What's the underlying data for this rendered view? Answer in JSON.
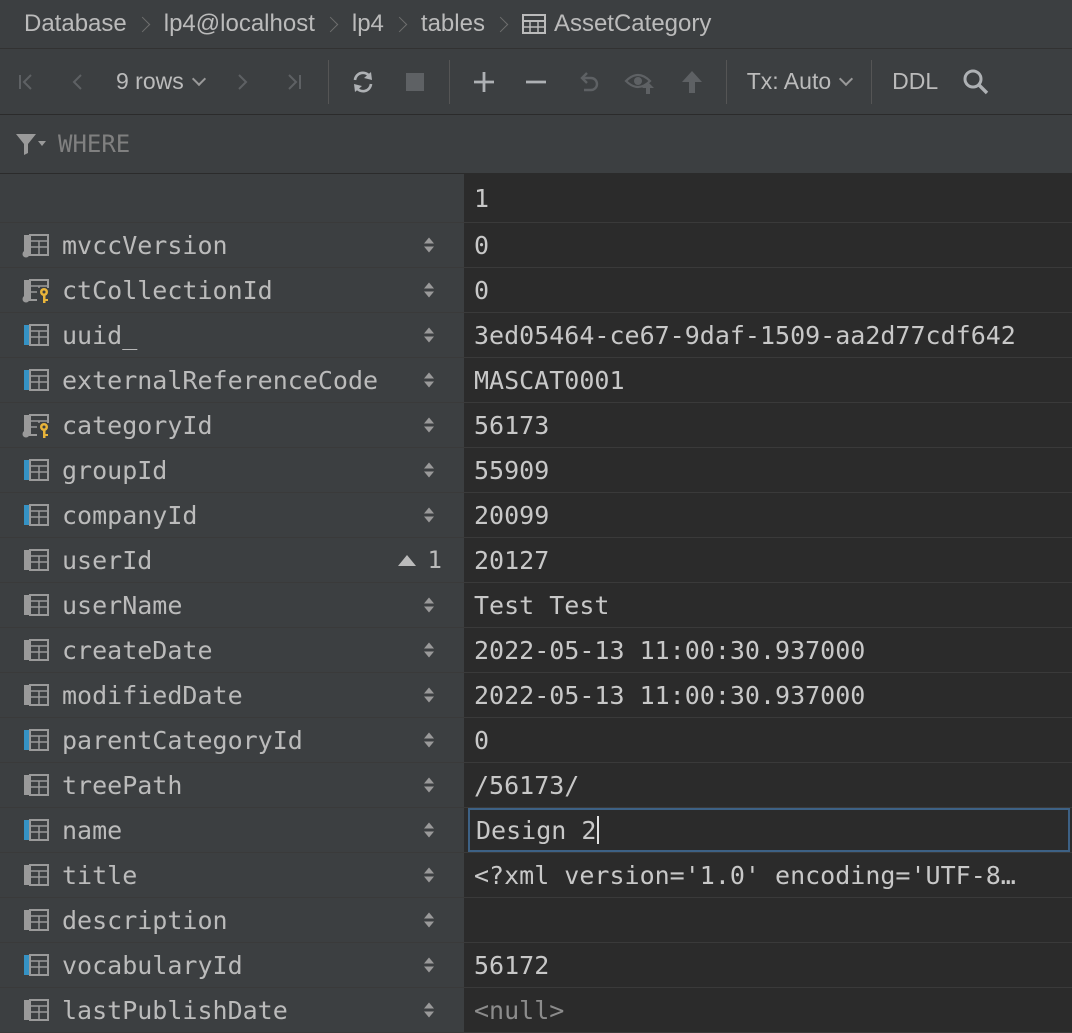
{
  "breadcrumb": [
    {
      "label": "Database",
      "icon": ""
    },
    {
      "label": "lp4@localhost",
      "icon": ""
    },
    {
      "label": "lp4",
      "icon": ""
    },
    {
      "label": "tables",
      "icon": ""
    },
    {
      "label": "AssetCategory",
      "icon": "table-icon"
    }
  ],
  "toolbar": {
    "rows_label": "9 rows",
    "tx_label": "Tx: Auto",
    "ddl_label": "DDL"
  },
  "filter": {
    "placeholder": "WHERE"
  },
  "grid": {
    "record_header": "1",
    "rows": [
      {
        "name": "mvccVersion",
        "value": "0",
        "icon": "column-icon",
        "key": false,
        "dot": true,
        "sort": null,
        "null": false
      },
      {
        "name": "ctCollectionId",
        "value": "0",
        "icon": "primary-key-column-icon",
        "key": true,
        "dot": true,
        "sort": null,
        "null": false
      },
      {
        "name": "uuid_",
        "value": "3ed05464-ce67-9daf-1509-aa2d77cdf642",
        "icon": "indexed-column-icon",
        "key": false,
        "dot": false,
        "sort": null,
        "null": false
      },
      {
        "name": "externalReferenceCode",
        "value": "MASCAT0001",
        "icon": "indexed-column-icon",
        "key": false,
        "dot": false,
        "sort": null,
        "null": false
      },
      {
        "name": "categoryId",
        "value": "56173",
        "icon": "primary-key-column-icon",
        "key": true,
        "dot": true,
        "sort": null,
        "null": false
      },
      {
        "name": "groupId",
        "value": "55909",
        "icon": "indexed-column-icon",
        "key": false,
        "dot": false,
        "sort": null,
        "null": false
      },
      {
        "name": "companyId",
        "value": "20099",
        "icon": "indexed-column-icon",
        "key": false,
        "dot": false,
        "sort": null,
        "null": false
      },
      {
        "name": "userId",
        "value": "20127",
        "icon": "column-icon",
        "key": false,
        "dot": false,
        "sort": "1",
        "null": false
      },
      {
        "name": "userName",
        "value": "Test Test",
        "icon": "column-icon",
        "key": false,
        "dot": false,
        "sort": null,
        "null": false
      },
      {
        "name": "createDate",
        "value": "2022-05-13 11:00:30.937000",
        "icon": "column-icon",
        "key": false,
        "dot": false,
        "sort": null,
        "null": false
      },
      {
        "name": "modifiedDate",
        "value": "2022-05-13 11:00:30.937000",
        "icon": "column-icon",
        "key": false,
        "dot": false,
        "sort": null,
        "null": false
      },
      {
        "name": "parentCategoryId",
        "value": "0",
        "icon": "indexed-column-icon",
        "key": false,
        "dot": false,
        "sort": null,
        "null": false
      },
      {
        "name": "treePath",
        "value": "/56173/",
        "icon": "column-icon",
        "key": false,
        "dot": false,
        "sort": null,
        "null": false
      },
      {
        "name": "name",
        "value": "Design 2",
        "icon": "indexed-column-icon",
        "key": false,
        "dot": false,
        "sort": null,
        "null": false,
        "editing": true
      },
      {
        "name": "title",
        "value": "<?xml version='1.0' encoding='UTF-8…",
        "icon": "column-icon",
        "key": false,
        "dot": false,
        "sort": null,
        "null": false
      },
      {
        "name": "description",
        "value": "",
        "icon": "column-icon",
        "key": false,
        "dot": false,
        "sort": null,
        "null": false
      },
      {
        "name": "vocabularyId",
        "value": "56172",
        "icon": "indexed-column-icon",
        "key": false,
        "dot": false,
        "sort": null,
        "null": false
      },
      {
        "name": "lastPublishDate",
        "value": "<null>",
        "icon": "column-icon",
        "key": false,
        "dot": false,
        "sort": null,
        "null": true
      }
    ]
  },
  "colors": {
    "background": "#2b2b2b",
    "panel": "#3c3f41",
    "text": "#bbbbbb",
    "index_accent": "#3592c4",
    "key_accent": "#e8b43a",
    "edit_border": "#3d6185"
  }
}
